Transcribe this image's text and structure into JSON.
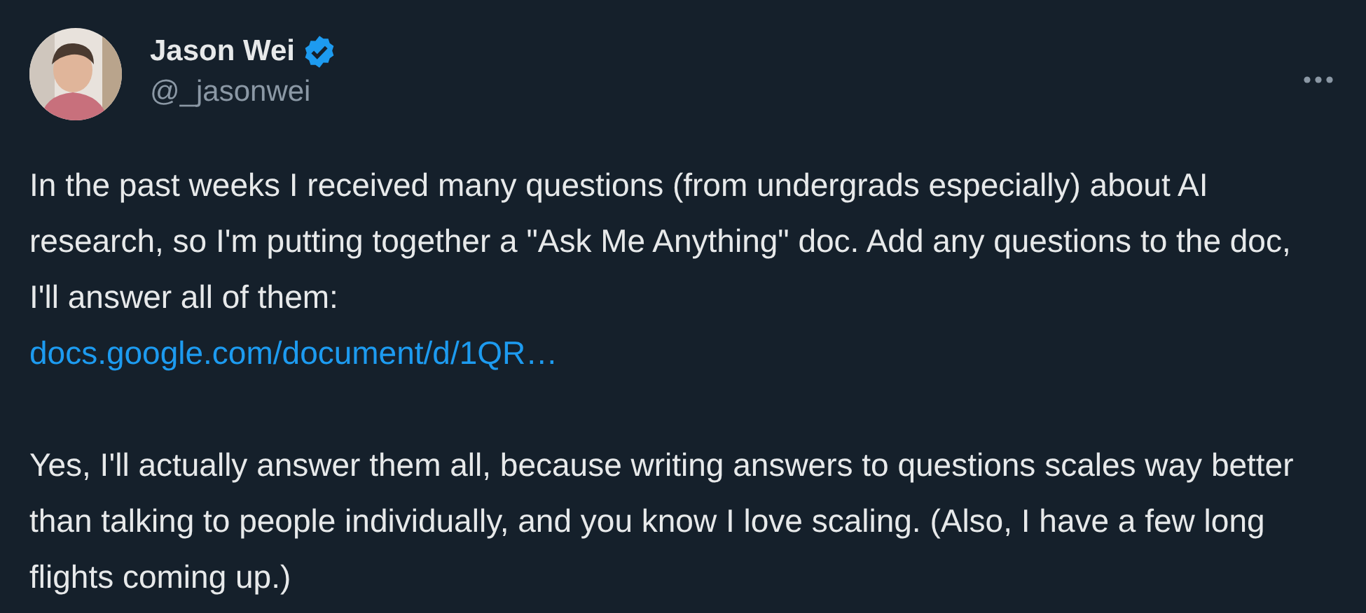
{
  "author": {
    "name": "Jason Wei",
    "verified": true,
    "handle": "@_jasonwei"
  },
  "paragraphs": [
    {
      "text": "In the past weeks I received many questions (from undergrads especially) about AI research, so I'm putting together a \"Ask Me Anything\" doc. Add any questions to the doc, I'll answer all of them:",
      "link": "docs.google.com/document/d/1QR…"
    },
    {
      "text": "Yes, I'll actually answer them all, because writing answers to questions scales way better than talking to people individually, and you know I love scaling. (Also, I have a few long flights coming up.)"
    }
  ]
}
